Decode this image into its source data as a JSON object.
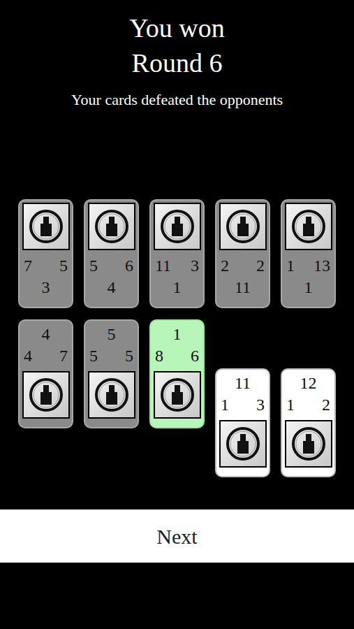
{
  "result": {
    "title": "You won",
    "round": "Round 6",
    "subtitle": "Your cards defeated the opponents"
  },
  "opponent_cards": [
    {
      "left": "7",
      "right": "5",
      "bottom": "3"
    },
    {
      "left": "5",
      "right": "6",
      "bottom": "4"
    },
    {
      "left": "11",
      "right": "3",
      "bottom": "1"
    },
    {
      "left": "2",
      "right": "2",
      "bottom": "11"
    },
    {
      "left": "1",
      "right": "13",
      "bottom": "1"
    }
  ],
  "player_cards": [
    {
      "top": "4",
      "left": "4",
      "right": "7",
      "kind": "played",
      "selected": false
    },
    {
      "top": "5",
      "left": "5",
      "right": "5",
      "kind": "played",
      "selected": false
    },
    {
      "top": "1",
      "left": "8",
      "right": "6",
      "kind": "played",
      "selected": true
    },
    {
      "top": "11",
      "left": "1",
      "right": "3",
      "kind": "hand",
      "selected": false
    },
    {
      "top": "12",
      "left": "1",
      "right": "2",
      "kind": "hand",
      "selected": false
    }
  ],
  "buttons": [
    "Next"
  ]
}
